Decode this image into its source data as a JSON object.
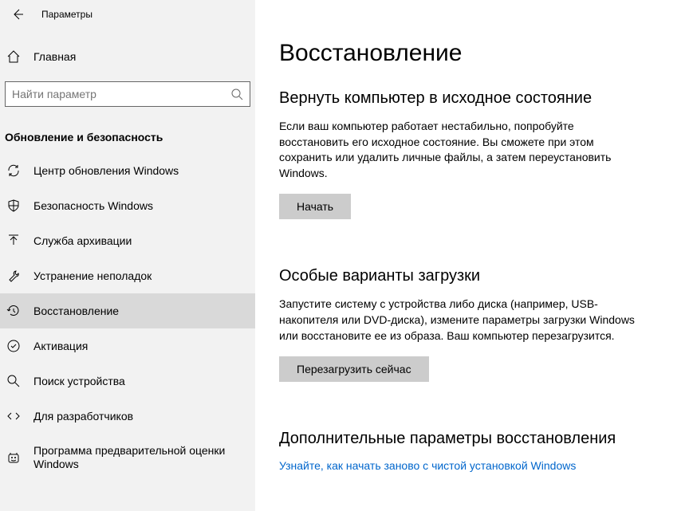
{
  "header": {
    "title": "Параметры"
  },
  "home": {
    "label": "Главная"
  },
  "search": {
    "placeholder": "Найти параметр"
  },
  "section": {
    "title": "Обновление и безопасность"
  },
  "nav": {
    "items": [
      {
        "label": "Центр обновления Windows"
      },
      {
        "label": "Безопасность Windows"
      },
      {
        "label": "Служба архивации"
      },
      {
        "label": "Устранение неполадок"
      },
      {
        "label": "Восстановление"
      },
      {
        "label": "Активация"
      },
      {
        "label": "Поиск устройства"
      },
      {
        "label": "Для разработчиков"
      },
      {
        "label": "Программа предварительной оценки Windows"
      }
    ]
  },
  "main": {
    "title": "Восстановление",
    "reset": {
      "heading": "Вернуть компьютер в исходное состояние",
      "text": "Если ваш компьютер работает нестабильно, попробуйте восстановить его исходное состояние. Вы сможете при этом сохранить или удалить личные файлы, а затем переустановить Windows.",
      "button": "Начать"
    },
    "advanced": {
      "heading": "Особые варианты загрузки",
      "text": "Запустите систему с устройства либо диска (например, USB-накопителя или DVD-диска), измените параметры загрузки Windows или восстановите ее из образа. Ваш компьютер перезагрузится.",
      "button": "Перезагрузить сейчас"
    },
    "more": {
      "heading": "Дополнительные параметры восстановления",
      "link": "Узнайте, как начать заново с чистой установкой Windows"
    }
  }
}
